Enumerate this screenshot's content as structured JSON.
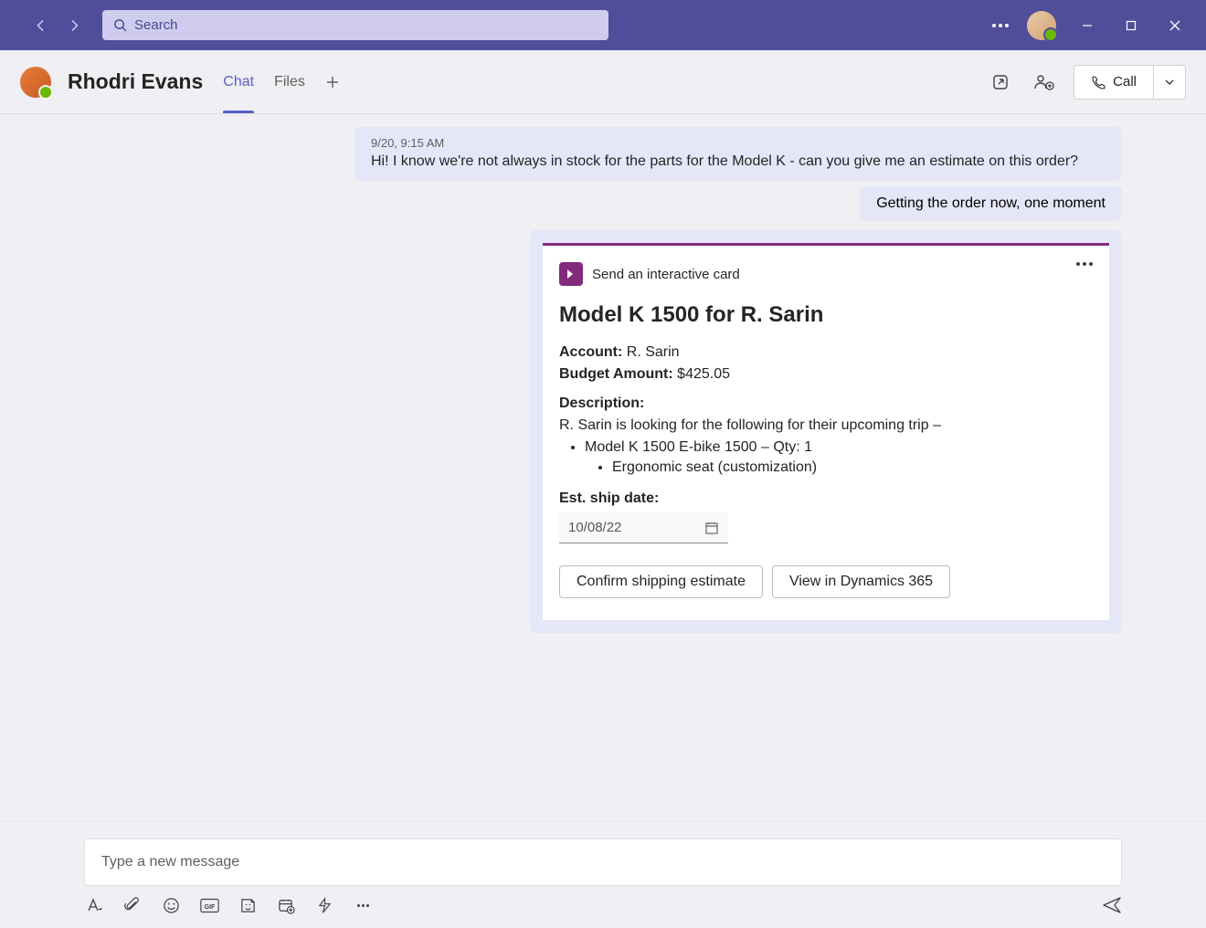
{
  "titlebar": {
    "search_placeholder": "Search"
  },
  "chat": {
    "title": "Rhodri Evans",
    "tabs": {
      "chat": "Chat",
      "files": "Files"
    },
    "call_label": "Call"
  },
  "messages": {
    "incoming": {
      "timestamp": "9/20, 9:15 AM",
      "text": "Hi! I know we're not always in stock for the parts for the Model K - can you give me an estimate on this order?"
    },
    "outgoing": {
      "text": "Getting the order now, one moment"
    }
  },
  "card": {
    "source": "Send an interactive card",
    "title": "Model K 1500 for R. Sarin",
    "account_label": "Account:",
    "account_value": "R. Sarin",
    "budget_label": "Budget Amount:",
    "budget_value": "$425.05",
    "description_label": "Description:",
    "description_intro": "R. Sarin is looking for the following for their upcoming trip –",
    "line_item": "Model K 1500 E-bike 1500 – Qty: 1",
    "sub_item": "Ergonomic seat (customization)",
    "ship_label": "Est. ship date:",
    "ship_value": "10/08/22",
    "btn_confirm": "Confirm shipping estimate",
    "btn_view": "View in Dynamics 365"
  },
  "composer": {
    "placeholder": "Type a new message"
  }
}
